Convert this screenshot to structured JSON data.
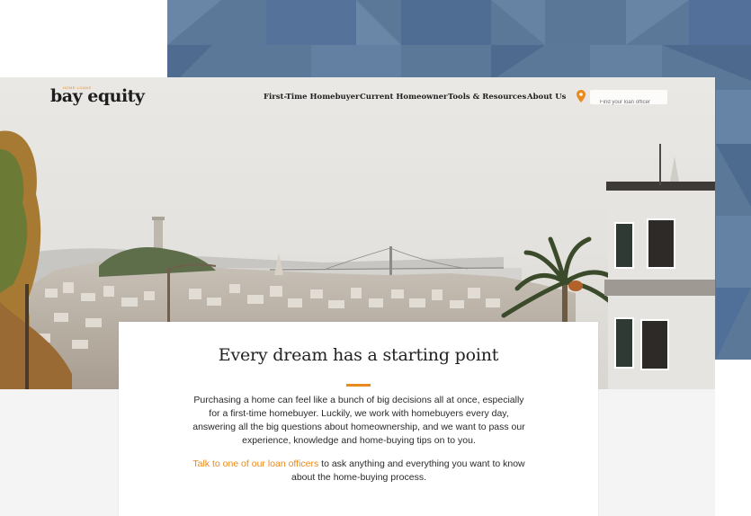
{
  "nav": {
    "logo_text": "bay equity",
    "logo_tagline": "HOME LOANS",
    "links": [
      "First-Time Homebuyer",
      "Current Homeowner",
      "Tools & Resources",
      "About Us"
    ],
    "search_placeholder": "Find your loan officer"
  },
  "hero": {
    "heading": "Every dream has a starting point",
    "paragraph": "Purchasing a home can feel like a bunch of big decisions all at once, especially for a first-time homebuyer. Luckily, we work with homebuyers every day, answering all the big questions about homeownership, and we want to pass our experience, knowledge and home-buying tips on to you.",
    "cta_link": "Talk to one of our loan officers",
    "cta_rest": " to ask anything and everything you want to know about the home-buying process."
  },
  "colors": {
    "accent": "#e98a1e",
    "backdrop": "#5d7a9c"
  },
  "icons": [
    "location-pin-icon"
  ]
}
